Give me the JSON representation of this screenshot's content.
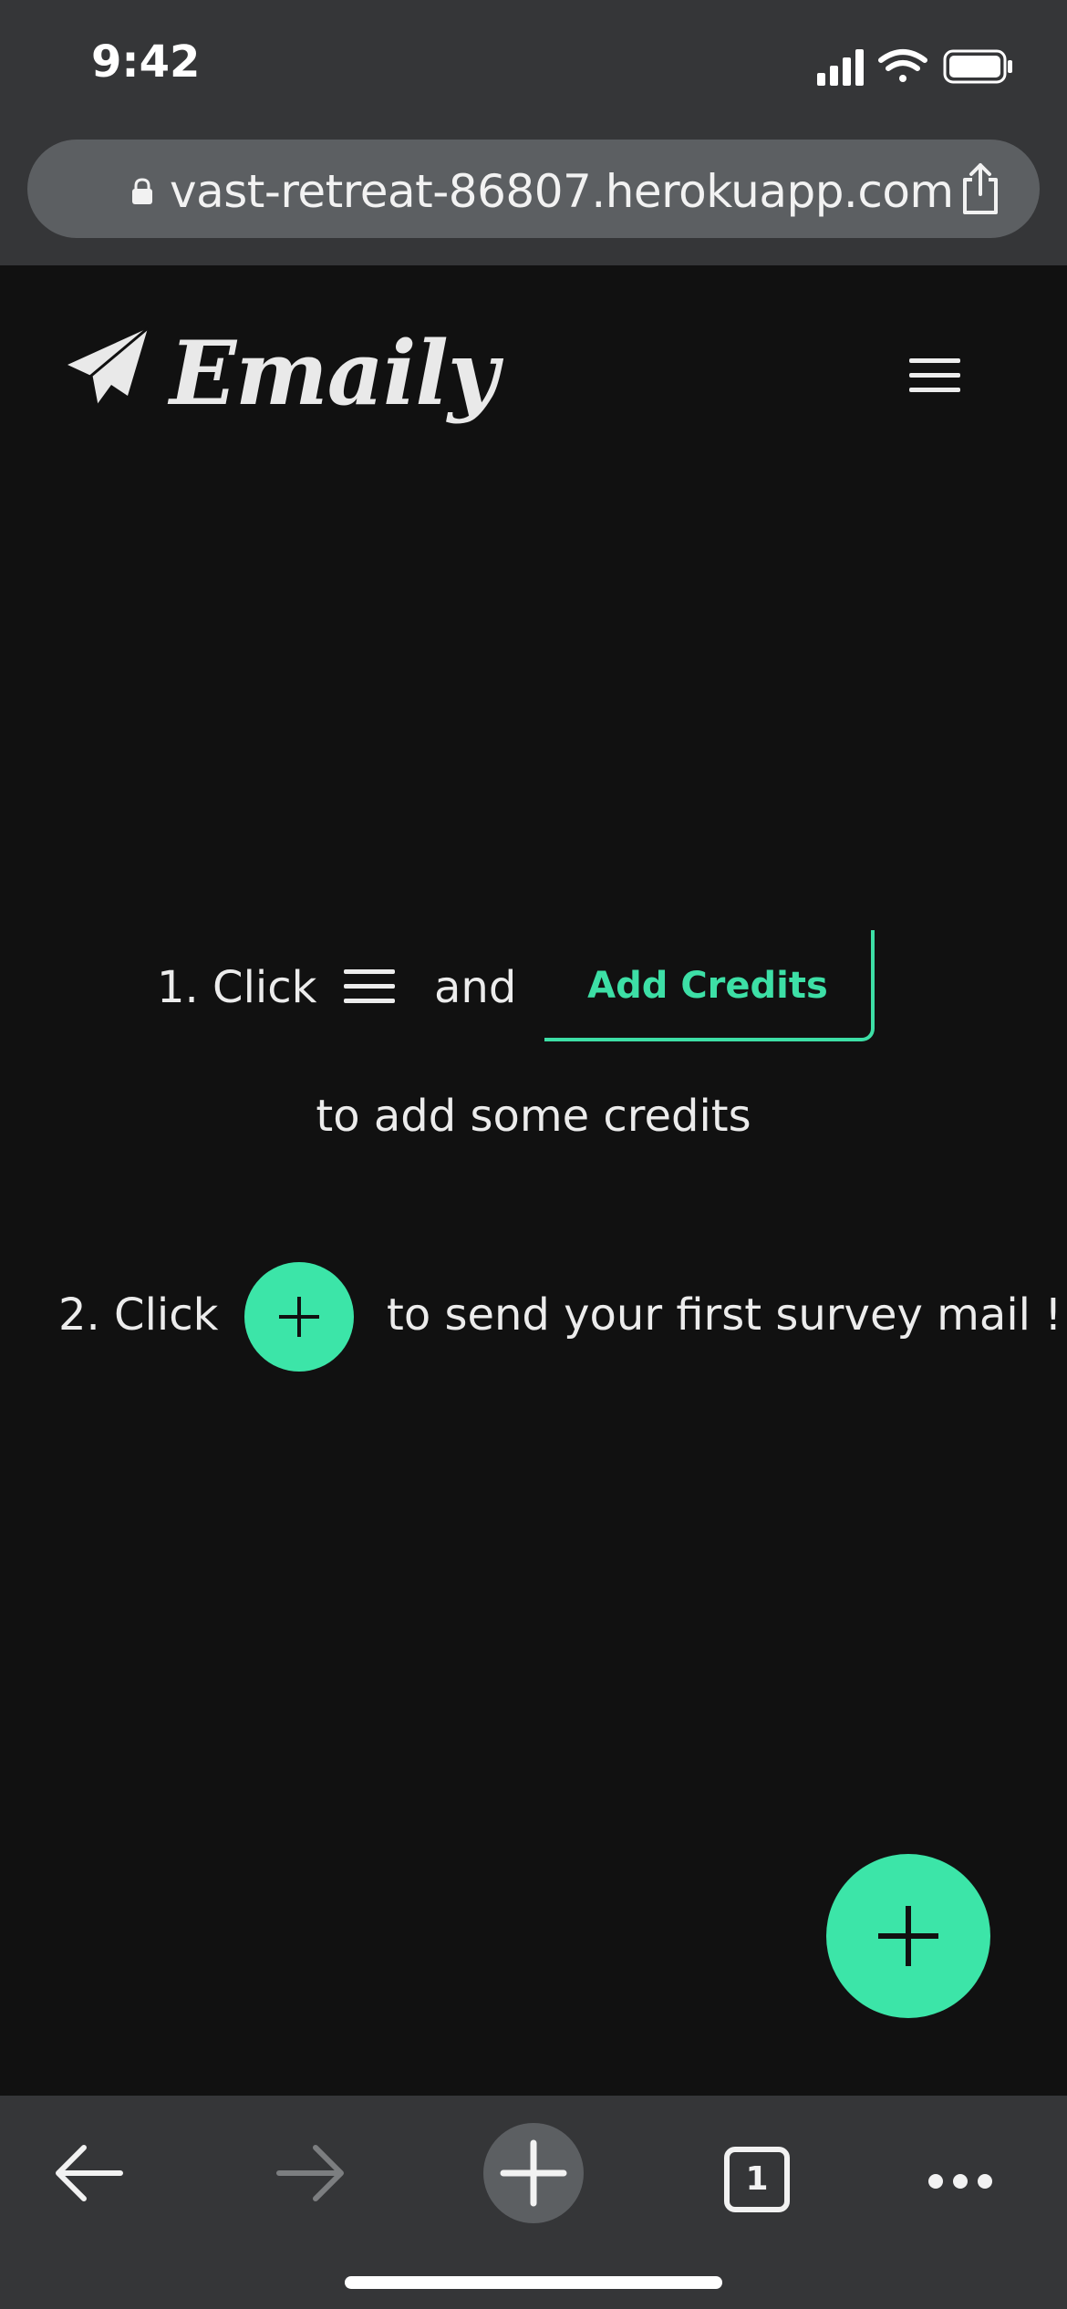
{
  "status_bar": {
    "time": "9:42"
  },
  "browser": {
    "url": "vast-retreat-86807.herokuapp.com",
    "tab_count": "1"
  },
  "app": {
    "brand": "Emaily"
  },
  "instructions": {
    "step1_prefix": "1. Click",
    "step1_and": "and",
    "add_credits_label": "Add Credits",
    "step1_suffix": "to add some credits",
    "step2_prefix": "2. Click",
    "step2_suffix": "to send your first survey mail !"
  },
  "colors": {
    "accent": "#3ce5a8",
    "background": "#111111",
    "browser_chrome": "#353638"
  },
  "icons": {
    "logo": "paper-plane-icon",
    "menu": "hamburger-menu-icon",
    "fab": "plus-icon"
  }
}
